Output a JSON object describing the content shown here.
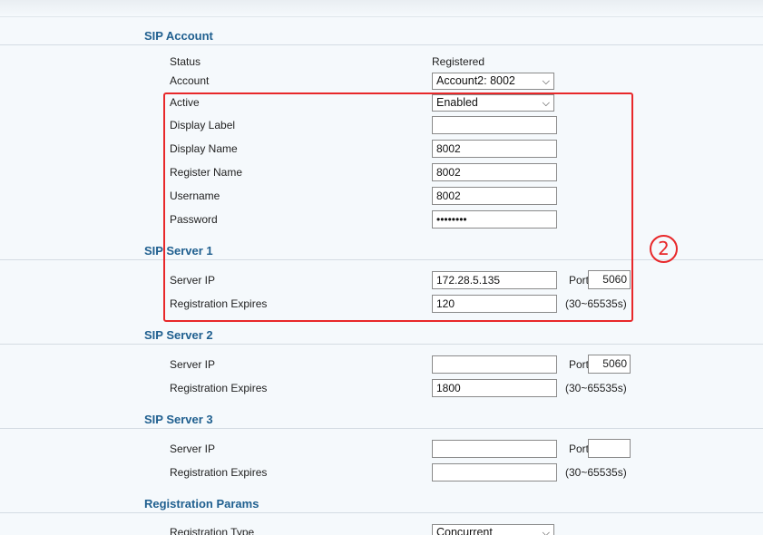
{
  "sections": {
    "sip_account": "SIP Account",
    "sip_server_1": "SIP Server 1",
    "sip_server_2": "SIP Server 2",
    "sip_server_3": "SIP Server 3",
    "registration_params": "Registration Params"
  },
  "account": {
    "status_label": "Status",
    "status_value": "Registered",
    "account_label": "Account",
    "account_value": "Account2: 8002",
    "active_label": "Active",
    "active_value": "Enabled",
    "display_label_label": "Display Label",
    "display_label_value": "",
    "display_name_label": "Display Name",
    "display_name_value": "8002",
    "register_name_label": "Register Name",
    "register_name_value": "8002",
    "username_label": "Username",
    "username_value": "8002",
    "password_label": "Password",
    "password_value": "••••••••"
  },
  "server1": {
    "server_ip_label": "Server IP",
    "server_ip_value": "172.28.5.135",
    "port_label": "Port",
    "port_value": "5060",
    "expires_label": "Registration Expires",
    "expires_value": "120",
    "expires_hint": "(30~65535s)"
  },
  "server2": {
    "server_ip_label": "Server IP",
    "server_ip_value": "",
    "port_label": "Port",
    "port_value": "5060",
    "expires_label": "Registration Expires",
    "expires_value": "1800",
    "expires_hint": "(30~65535s)"
  },
  "server3": {
    "server_ip_label": "Server IP",
    "server_ip_value": "",
    "port_label": "Port",
    "port_value": "",
    "expires_label": "Registration Expires",
    "expires_value": "",
    "expires_hint": "(30~65535s)"
  },
  "params": {
    "registration_type_label": "Registration Type",
    "registration_type_value": "Concurrent"
  },
  "annotation": {
    "number": "2",
    "color": "#e8282a"
  },
  "colors": {
    "section_title": "#1f5f8f",
    "background": "#f5f9fc"
  }
}
